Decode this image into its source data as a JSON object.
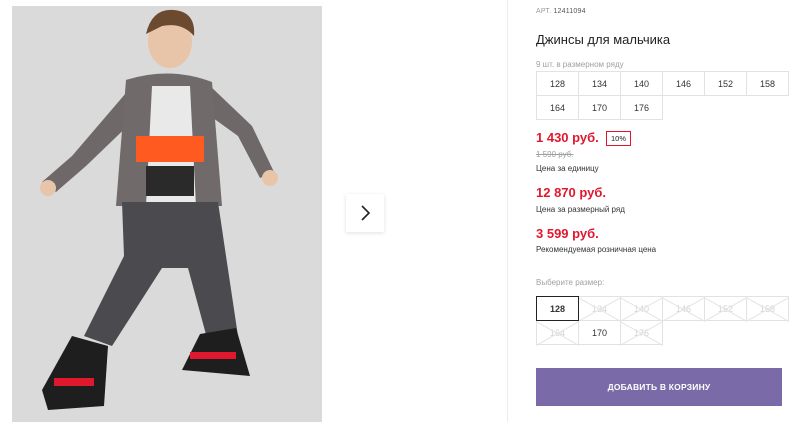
{
  "product": {
    "article_label": "АРТ.",
    "article_value": "12411094",
    "title": "Джинсы для мальчика"
  },
  "size_range": {
    "label": "9 шт. в размерном ряду",
    "sizes": [
      "128",
      "134",
      "140",
      "146",
      "152",
      "158",
      "164",
      "170",
      "176"
    ]
  },
  "pricing": {
    "unit_price": "1 430 руб.",
    "discount": "10%",
    "old_price": "1 590 руб.",
    "unit_caption": "Цена за единицу",
    "range_price": "12 870 руб.",
    "range_caption": "Цена за размерный ряд",
    "retail_price": "3 599 руб.",
    "retail_caption": "Рекомендуемая розничная цена",
    "accent_color": "#e0182e"
  },
  "size_select": {
    "label": "Выберите размер:",
    "options": [
      {
        "label": "128",
        "state": "selected"
      },
      {
        "label": "134",
        "state": "unavailable"
      },
      {
        "label": "140",
        "state": "unavailable"
      },
      {
        "label": "146",
        "state": "unavailable"
      },
      {
        "label": "152",
        "state": "unavailable"
      },
      {
        "label": "158",
        "state": "unavailable"
      },
      {
        "label": "164",
        "state": "unavailable"
      },
      {
        "label": "170",
        "state": "available"
      },
      {
        "label": "176",
        "state": "unavailable"
      }
    ]
  },
  "cart": {
    "button_label": "ДОБАВИТЬ В КОРЗИНУ",
    "button_color": "#7a6aa8"
  },
  "gallery": {
    "next_icon": "chevron-right-icon"
  }
}
